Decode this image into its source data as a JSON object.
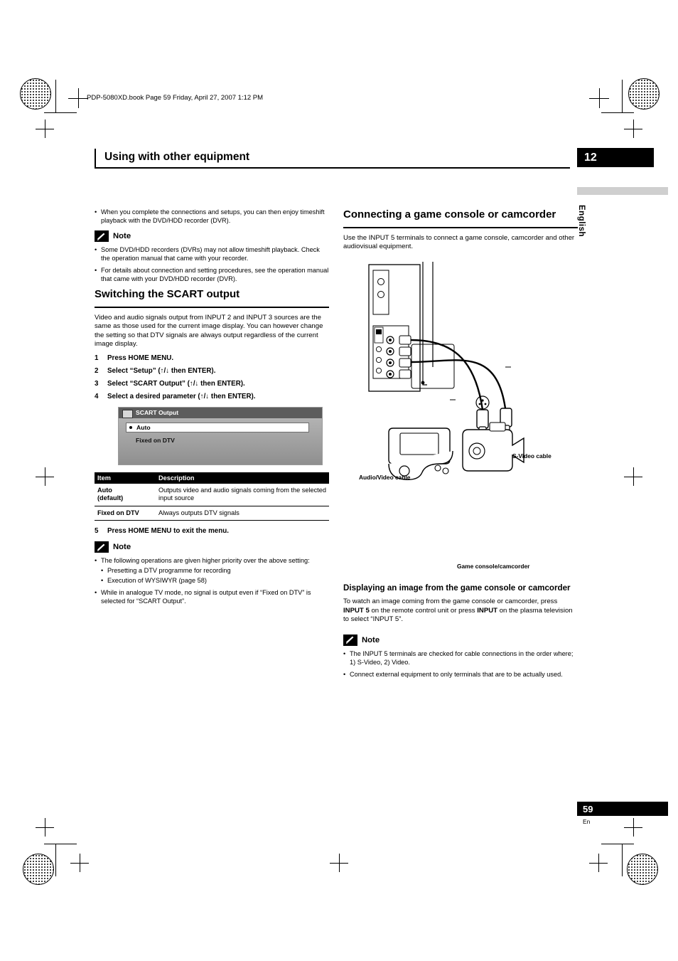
{
  "header": {
    "filepath": "PDP-5080XD.book  Page 59  Friday, April 27, 2007  1:12 PM",
    "chapter_title": "Using with other equipment",
    "chapter_number": "12",
    "language": "English"
  },
  "footer": {
    "page_number": "59",
    "page_suffix": "En"
  },
  "left_column": {
    "intro_bullet": "When you complete the connections and setups, you can then enjoy timeshift playback with the DVD/HDD recorder (DVR).",
    "note1": {
      "title": "Note",
      "items": [
        "Some DVD/HDD recorders (DVRs) may not allow timeshift playback. Check the operation manual that came with your recorder.",
        "For details about connection and setting procedures, see the operation manual that came with your DVD/HDD recorder (DVR)."
      ]
    },
    "section_title": "Switching the SCART output",
    "body": "Video and audio signals output from INPUT 2 and INPUT 3 sources are the same as those used for the current image display. You can however change the setting so that DTV signals are always output regardless of the current image display.",
    "steps": [
      {
        "n": "1",
        "text": "Press HOME MENU."
      },
      {
        "n": "2",
        "text": "Select “Setup” (↑/↓ then ENTER)."
      },
      {
        "n": "3",
        "text": "Select “SCART Output” (↑/↓ then ENTER)."
      },
      {
        "n": "4",
        "text": "Select a desired parameter (↑/↓ then ENTER)."
      },
      {
        "n": "5",
        "text": "Press HOME MENU to exit the menu."
      }
    ],
    "osd": {
      "title": "SCART Output",
      "option_selected": "Auto",
      "option_other": "Fixed on DTV"
    },
    "table": {
      "headers": [
        "Item",
        "Description"
      ],
      "rows": [
        {
          "item": "Auto",
          "item_note": "(default)",
          "description": "Outputs video and audio signals coming from the selected input source"
        },
        {
          "item": "Fixed on DTV",
          "item_note": "",
          "description": "Always outputs DTV signals"
        }
      ]
    },
    "note2": {
      "title": "Note",
      "items": [
        "The following operations are given higher priority over the above setting:",
        "Presetting a DTV programme for recording",
        "Execution of WYSIWYR (page 58)",
        "While in analogue TV mode, no signal is output even if “Fixed on DTV” is selected for “SCART Output”."
      ]
    }
  },
  "right_column": {
    "section_title": "Connecting a game console or camcorder",
    "body": "Use the INPUT 5 terminals to connect a game console, camcorder and other audiovisual equipment.",
    "diagram_labels": {
      "svideo": "S-Video cable",
      "audio_video": "Audio/Video cable",
      "device": "Game console/camcorder"
    },
    "subsection_title": "Displaying an image from the game console or camcorder",
    "subsection_body_1": "To watch an image coming from the game console or camcorder, press ",
    "subsection_body_bold_1": "INPUT 5",
    "subsection_body_2": " on the remote control unit or press ",
    "subsection_body_bold_2": "INPUT",
    "subsection_body_3": " on the plasma television to select “INPUT 5”.",
    "note": {
      "title": "Note",
      "items": [
        "The INPUT 5 terminals are checked for cable connections in the order where; 1) S-Video, 2) Video.",
        "Connect external equipment to only terminals that are to be actually used."
      ]
    }
  },
  "colors": {
    "black": "#000000",
    "gray_bar": "#cfcfcf",
    "osd_title_bg": "#5c5c5c"
  }
}
